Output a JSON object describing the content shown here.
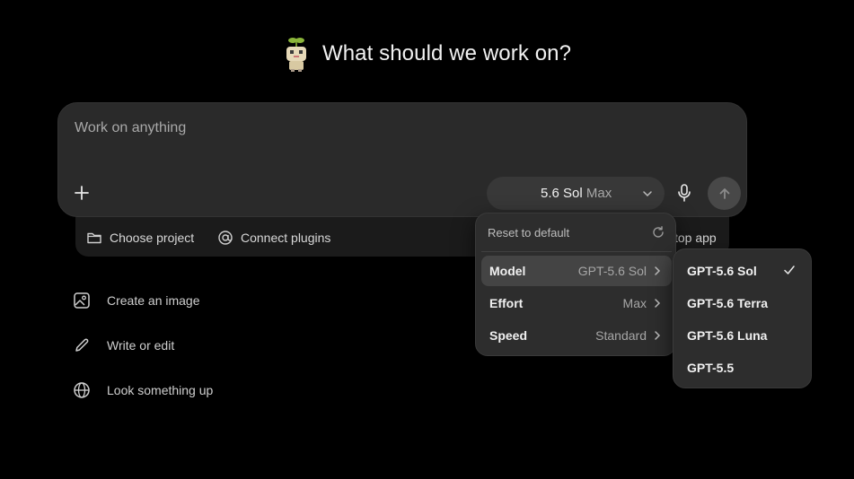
{
  "header": {
    "title": "What should we work on?",
    "mascot_icon": "sprout-robot-icon"
  },
  "composer": {
    "placeholder": "Work on anything",
    "model_name": "5.6 Sol",
    "effort_label": "Max",
    "add_icon": "plus-icon",
    "mic_icon": "microphone-icon",
    "send_icon": "arrow-up-icon"
  },
  "toolbar": {
    "choose_project": "Choose project",
    "connect_plugins": "Connect plugins",
    "desktop_app": "top app"
  },
  "suggestions": [
    {
      "label": "Create an image",
      "icon": "image-icon"
    },
    {
      "label": "Write or edit",
      "icon": "pencil-icon"
    },
    {
      "label": "Look something up",
      "icon": "globe-icon"
    }
  ],
  "menu": {
    "reset_label": "Reset to default",
    "rows": [
      {
        "key": "Model",
        "value": "GPT-5.6 Sol",
        "active": true
      },
      {
        "key": "Effort",
        "value": "Max",
        "active": false
      },
      {
        "key": "Speed",
        "value": "Standard",
        "active": false
      }
    ]
  },
  "submenu": {
    "options": [
      "GPT-5.6 Sol",
      "GPT-5.6 Terra",
      "GPT-5.6 Luna",
      "GPT-5.5"
    ],
    "selected": "GPT-5.6 Sol"
  },
  "colors": {
    "background": "#000000",
    "composer": "#2a2a2a",
    "menu": "#2d2d2d",
    "active_row": "#444444"
  }
}
